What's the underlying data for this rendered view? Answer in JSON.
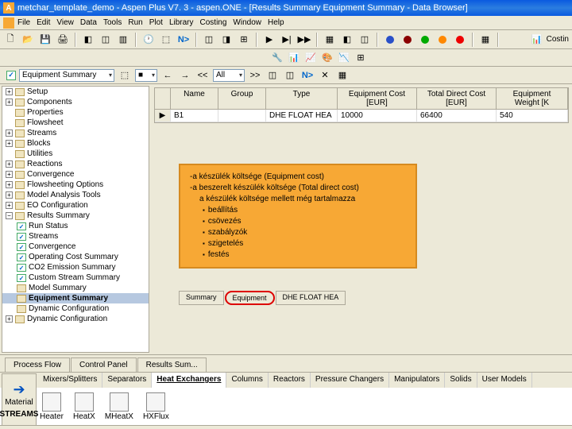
{
  "title": "metchar_template_demo - Aspen Plus V7. 3 - aspen.ONE - [Results Summary Equipment Summary - Data Browser]",
  "menu": [
    "File",
    "Edit",
    "View",
    "Data",
    "Tools",
    "Run",
    "Plot",
    "Library",
    "Costing",
    "Window",
    "Help"
  ],
  "costin_btn": "Costin",
  "navbar": {
    "node": "Equipment Summary",
    "filter": "All"
  },
  "nav_symbols": {
    "back": "←",
    "fwd": "→",
    "ll": "<<",
    "rr": ">>"
  },
  "circles": {
    "blue": "#2a50c8",
    "darkred": "#8b0000",
    "green": "#0a0",
    "orange": "#f80",
    "red": "#e00"
  },
  "tree_l1": [
    {
      "label": "Setup",
      "plus": "+",
      "chk": false
    },
    {
      "label": "Components",
      "plus": "+",
      "chk": false
    },
    {
      "label": "Properties",
      "plus": "",
      "chk": false
    },
    {
      "label": "Flowsheet",
      "plus": "",
      "chk": false
    },
    {
      "label": "Streams",
      "plus": "+",
      "chk": false
    },
    {
      "label": "Blocks",
      "plus": "+",
      "chk": false
    },
    {
      "label": "Utilities",
      "plus": "",
      "chk": false
    },
    {
      "label": "Reactions",
      "plus": "+",
      "chk": false
    },
    {
      "label": "Convergence",
      "plus": "+",
      "chk": false
    },
    {
      "label": "Flowsheeting Options",
      "plus": "+",
      "chk": false
    },
    {
      "label": "Model Analysis Tools",
      "plus": "+",
      "chk": false
    },
    {
      "label": "EO Configuration",
      "plus": "+",
      "chk": false
    },
    {
      "label": "Results Summary",
      "plus": "−",
      "chk": false
    }
  ],
  "tree_l2": [
    {
      "label": "Run Status",
      "chk": true
    },
    {
      "label": "Streams",
      "chk": true
    },
    {
      "label": "Convergence",
      "chk": true
    },
    {
      "label": "Operating Cost Summary",
      "chk": true
    },
    {
      "label": "CO2 Emission Summary",
      "chk": true
    },
    {
      "label": "Custom Stream Summary",
      "chk": true
    },
    {
      "label": "Model Summary",
      "chk": false
    },
    {
      "label": "Equipment Summary",
      "chk": false,
      "sel": true
    },
    {
      "label": "Dynamic Configuration",
      "chk": false
    }
  ],
  "tree_after": {
    "label": "Dynamic Configuration",
    "plus": "+"
  },
  "grid": {
    "headers": [
      "",
      "Name",
      "Group",
      "Type",
      "Equipment Cost [EUR]",
      "Total Direct Cost [EUR]",
      "Equipment Weight [K"
    ],
    "row_marker": "▶",
    "row": [
      "B1",
      "",
      "DHE FLOAT HEA",
      "10000",
      "66400",
      "540"
    ]
  },
  "annotate": {
    "l1": "-a készülék költsége (Equipment cost)",
    "l2": "-a beszerelt készülék költsége (Total direct cost)",
    "l3": "a készülék költsége mellett még tartalmazza",
    "items": [
      "beállítás",
      "csövezés",
      "szabályzók",
      "szigetelés",
      "festés"
    ]
  },
  "minitabs": [
    "Summary",
    "Equipment",
    "DHE FLOAT HEA"
  ],
  "bottom_tabs": [
    "Process Flow",
    "Control Panel",
    "Results Sum..."
  ],
  "palette_tabs": [
    "Mixers/Splitters",
    "Separators",
    "Heat Exchangers",
    "Columns",
    "Reactors",
    "Pressure Changers",
    "Manipulators",
    "Solids",
    "User Models"
  ],
  "palette_items": [
    "Heater",
    "HeatX",
    "MHeatX",
    "HXFlux"
  ],
  "streams_label": "STREAMS",
  "streams_sub": "Material"
}
